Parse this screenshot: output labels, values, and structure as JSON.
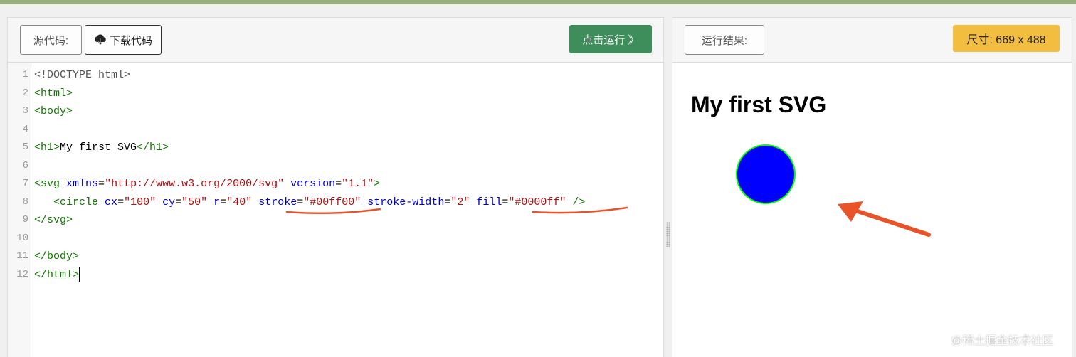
{
  "editor": {
    "source_label": "源代码:",
    "download_label": "下载代码",
    "run_label": "点击运行 》",
    "lines": [
      {
        "n": "1",
        "html": "<span class=\"meta\">&lt;!DOCTYPE html&gt;</span>"
      },
      {
        "n": "2",
        "html": "<span class=\"tag\">&lt;html&gt;</span>"
      },
      {
        "n": "3",
        "html": "<span class=\"tag\">&lt;body&gt;</span>"
      },
      {
        "n": "4",
        "html": ""
      },
      {
        "n": "5",
        "html": "<span class=\"tag\">&lt;h1&gt;</span><span class=\"plain\">My first SVG</span><span class=\"tag\">&lt;/h1&gt;</span>"
      },
      {
        "n": "6",
        "html": ""
      },
      {
        "n": "7",
        "html": "<span class=\"tag\">&lt;svg</span> <span class=\"attr\">xmlns</span>=<span class=\"str\">\"http://www.w3.org/2000/svg\"</span> <span class=\"attr\">version</span>=<span class=\"str\">\"1.1\"</span><span class=\"tag\">&gt;</span>"
      },
      {
        "n": "8",
        "html": "   <span class=\"tag\">&lt;circle</span> <span class=\"attr\">cx</span>=<span class=\"str\">\"100\"</span> <span class=\"attr\">cy</span>=<span class=\"str\">\"50\"</span> <span class=\"attr\">r</span>=<span class=\"str\">\"40\"</span> <span class=\"attr\">stroke</span>=<span class=\"str\">\"#00ff00\"</span> <span class=\"attr\">stroke-width</span>=<span class=\"str\">\"2\"</span> <span class=\"attr\">fill</span>=<span class=\"str\">\"#0000ff\"</span> <span class=\"tag\">/&gt;</span>"
      },
      {
        "n": "9",
        "html": "<span class=\"tag\">&lt;/svg&gt;</span>"
      },
      {
        "n": "10",
        "html": ""
      },
      {
        "n": "11",
        "html": "<span class=\"tag\">&lt;/body&gt;</span>"
      },
      {
        "n": "12",
        "html": "<span class=\"tag\">&lt;/html&gt;</span><span class=\"cursor\"></span>"
      }
    ]
  },
  "preview": {
    "result_label": "运行结果:",
    "size_label": "尺寸: 669 x 488",
    "heading": "My first SVG",
    "circle": {
      "stroke": "#00ff00",
      "fill": "#0000ff"
    }
  },
  "watermark": "@稀土掘金技术社区",
  "colors": {
    "run_button": "#3e8e5c",
    "size_badge": "#f3bd3f",
    "annotation": "#e8532a"
  }
}
